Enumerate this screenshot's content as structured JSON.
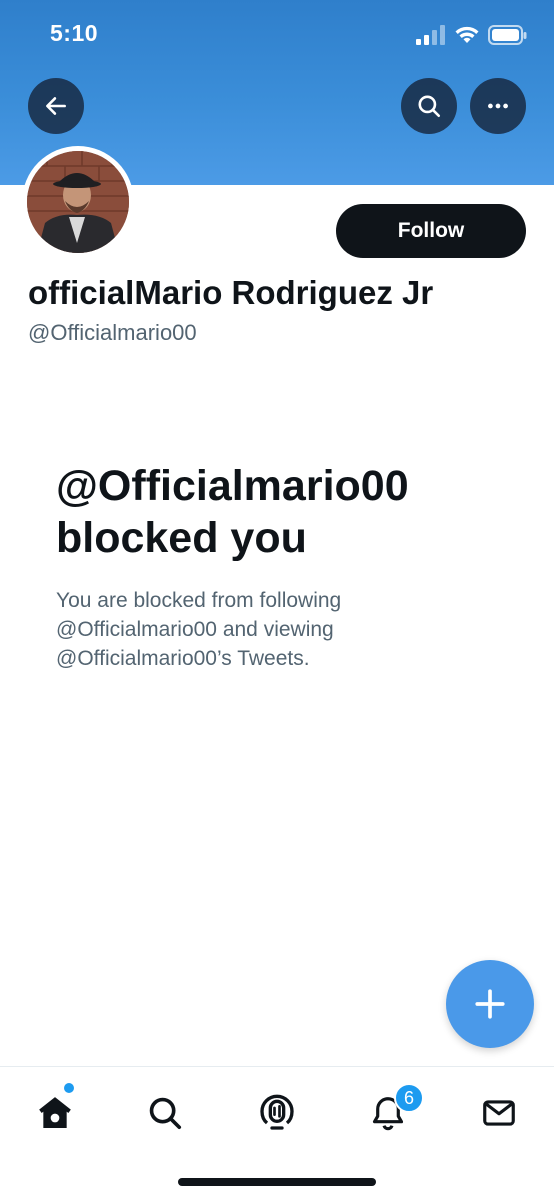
{
  "status_bar": {
    "time": "5:10"
  },
  "profile": {
    "display_name": "officialMario Rodriguez Jr",
    "handle": "@Officialmario00",
    "follow_label": "Follow"
  },
  "blocked": {
    "title": "@Officialmario00 blocked you",
    "description": "You are blocked from following @Officialmario00 and viewing @Officialmario00’s Tweets."
  },
  "tabbar": {
    "notifications_badge": "6"
  },
  "colors": {
    "header_blue": "#3b8ed9",
    "accent": "#1d9bf0",
    "fab": "#4a99e9",
    "text_primary": "#0f1419",
    "text_secondary": "#536471"
  },
  "icons": {
    "back": "arrow-left-icon",
    "search": "search-icon",
    "more": "more-horizontal-icon",
    "compose": "plus-icon",
    "home": "home-icon",
    "explore": "search-icon",
    "spaces": "microphone-icon",
    "notifications": "bell-icon",
    "messages": "envelope-icon"
  }
}
